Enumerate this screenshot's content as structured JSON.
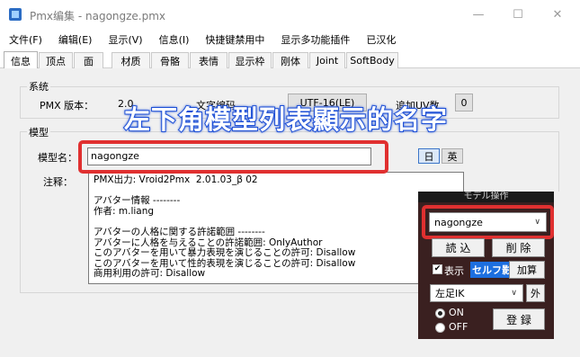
{
  "window": {
    "title": "Pmx编集 - nagongze.pmx"
  },
  "titlebar_buttons": {
    "minimize": "—",
    "maximize": "☐",
    "close": "✕"
  },
  "menu": [
    "文件(F)",
    "编辑(E)",
    "显示(V)",
    "信息(I)",
    "快捷键禁用中",
    "显示多功能插件",
    "已汉化"
  ],
  "tabs": [
    {
      "label": "信息",
      "active": true
    },
    {
      "label": "顶点"
    },
    {
      "label": "面"
    },
    {
      "label": "材质"
    },
    {
      "label": "骨骼"
    },
    {
      "label": "表情"
    },
    {
      "label": "显示枠"
    },
    {
      "label": "刚体"
    },
    {
      "label": "Joint"
    },
    {
      "label": "SoftBody"
    }
  ],
  "system_group": {
    "title": "系统",
    "version_label": "PMX 版本：",
    "version_value": "2.0",
    "encoding_label": "文字编码",
    "encoding_value": "UTF-16(LE)",
    "append_uv_label": "追加UV数",
    "append_uv_value": "0"
  },
  "model_group": {
    "title": "模型",
    "name_label": "模型名：",
    "name_value": "nagongze",
    "lang_jp": "日",
    "lang_en": "英",
    "comment_label": "注释：",
    "comment_lines": [
      "PMX出力: Vroid2Pmx  2.01.03_β 02",
      "",
      "アバター情報 --------",
      "作者: m.liang",
      "",
      "アバターの人格に関する許諾範囲 --------",
      "アバターに人格を与えることの許諾範囲: OnlyAuthor",
      "このアバターを用いて暴力表現を演じることの許可: Disallow",
      "このアバターを用いて性的表現を演じることの許可: Disallow",
      "商用利用の許可: Disallow"
    ]
  },
  "overlay_title": "左下角模型列表顯示的名字",
  "model_panel": {
    "header": "モデル操作",
    "selected_model": "nagongze",
    "load_button": "読 込",
    "delete_button": "削 除",
    "show_checkbox_label": "表示",
    "self_shadow_label": "セルフ影",
    "add_button": "加算",
    "ik_selected": "左足IK",
    "outer_button": "外",
    "on_label": "ON",
    "off_label": "OFF",
    "register_button": "登 録"
  },
  "colors": {
    "highlight_red": "#e03030",
    "overlay_outline": "#1d4fd6",
    "panel_bg": "#3a2020"
  }
}
